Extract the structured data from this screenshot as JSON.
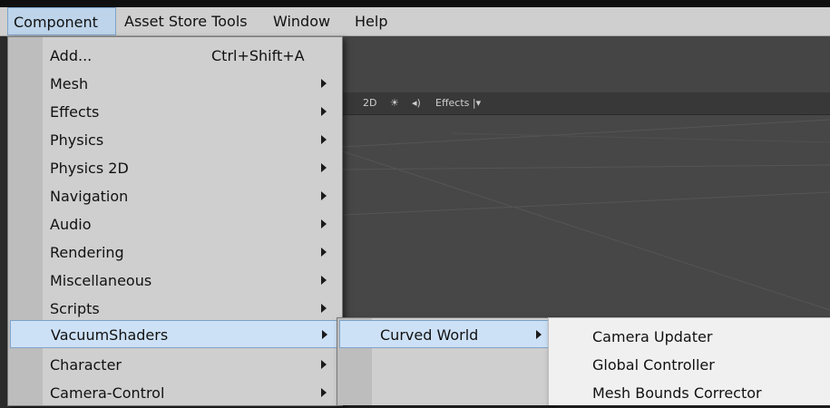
{
  "menubar": {
    "items": [
      {
        "label": "Component"
      },
      {
        "label": "Asset Store Tools"
      },
      {
        "label": "Window"
      },
      {
        "label": "Help"
      }
    ]
  },
  "component_menu": {
    "items": [
      {
        "label": "Add...",
        "shortcut": "Ctrl+Shift+A"
      },
      {
        "label": "Mesh"
      },
      {
        "label": "Effects"
      },
      {
        "label": "Physics"
      },
      {
        "label": "Physics 2D"
      },
      {
        "label": "Navigation"
      },
      {
        "label": "Audio"
      },
      {
        "label": "Rendering"
      },
      {
        "label": "Miscellaneous"
      },
      {
        "label": "Scripts"
      },
      {
        "label": "VacuumShaders"
      },
      {
        "label": "Character"
      },
      {
        "label": "Camera-Control"
      }
    ]
  },
  "vacuum_submenu": {
    "items": [
      {
        "label": "Curved World"
      }
    ]
  },
  "curved_world_submenu": {
    "items": [
      {
        "label": "Camera Updater"
      },
      {
        "label": "Global Controller"
      },
      {
        "label": "Mesh Bounds Corrector"
      }
    ]
  },
  "scene_toolbar": {
    "mode_2d": "2D",
    "effects": "Effects"
  },
  "colors": {
    "menu_bg": "#cfcfcf",
    "highlight": "#cde1f6",
    "highlight_border": "#7ea3c8",
    "editor_bg": "#454545"
  },
  "icons": {
    "submenu": "chevron-right-icon",
    "lighting": "sun-icon",
    "audio": "speaker-icon"
  }
}
